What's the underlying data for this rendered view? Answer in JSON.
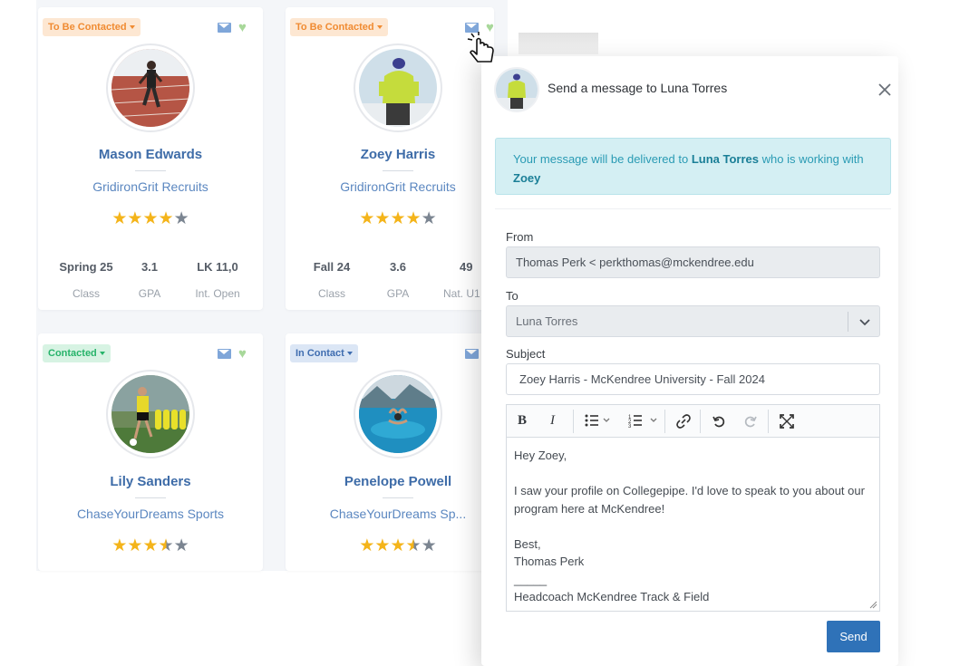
{
  "cards": [
    {
      "status": "To Be Contacted",
      "name": "Mason Edwards",
      "org": "GridironGrit Recruits",
      "rating": 4,
      "stats": [
        {
          "value": "Spring 25",
          "label": "Class"
        },
        {
          "value": "3.1",
          "label": "GPA"
        },
        {
          "value": "LK 11,0",
          "label": "Int. Open"
        }
      ]
    },
    {
      "status": "To Be Contacted",
      "name": "Zoey Harris",
      "org": "GridironGrit Recruits",
      "rating": 4,
      "stats": [
        {
          "value": "Fall 24",
          "label": "Class"
        },
        {
          "value": "3.6",
          "label": "GPA"
        },
        {
          "value": "49",
          "label": "Nat. U1"
        }
      ]
    },
    {
      "status": "Contacted",
      "name": "Lily Sanders",
      "org": "ChaseYourDreams Sports",
      "rating": 3.5
    },
    {
      "status": "In Contact",
      "name": "Penelope Powell",
      "org": "ChaseYourDreams Sp...",
      "rating": 3.5
    }
  ],
  "modal": {
    "title": "Send a message to Luna Torres",
    "info_prefix": "Your message will be delivered to",
    "info_recipient": "Luna Torres",
    "info_middle": "who is working with",
    "info_athlete": "Zoey",
    "from_label": "From",
    "from_value": "Thomas Perk < perkthomas@mckendree.edu",
    "to_label": "To",
    "to_value": "Luna Torres",
    "subject_label": "Subject",
    "subject_value": "Zoey Harris - McKendree University - Fall 2024",
    "body_lines": [
      "Hey Zoey,",
      "",
      "I saw your profile on Collegepipe. I'd love to speak to you about our program here at McKendree!",
      "",
      "Best,",
      "Thomas Perk",
      "_____",
      "Headcoach McKendree Track & Field"
    ],
    "send_label": "Send"
  },
  "colors": {
    "accent": "#2f72b8",
    "name_blue": "#3e6ca8",
    "star": "#f4b41a",
    "badge_orange": "#f08b32",
    "badge_green": "#27b36a",
    "badge_blue": "#3f6db0",
    "info_bg": "#d4eff3"
  }
}
